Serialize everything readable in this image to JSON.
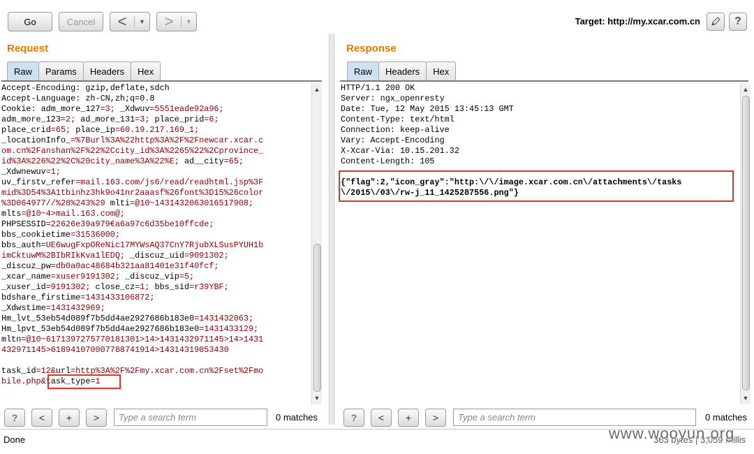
{
  "toolbar": {
    "go_label": "Go",
    "cancel_label": "Cancel",
    "back_glyph": "<",
    "forward_glyph": ">",
    "dropdown_glyph": "▼",
    "target_label": "Target: http://my.xcar.com.cn",
    "help_glyph": "?"
  },
  "request": {
    "title": "Request",
    "tabs": [
      "Raw",
      "Params",
      "Headers",
      "Hex"
    ],
    "active_tab": "Raw",
    "lines": [
      [
        {
          "t": "Accept-Encoding: gzip,deflate,sdch",
          "c": "k"
        }
      ],
      [
        {
          "t": "Accept-Language: zh-CN,zh;q=0.8",
          "c": "k"
        }
      ],
      [
        {
          "t": "Cookie: ",
          "c": "k"
        },
        {
          "t": "adm_more_127",
          "c": "k"
        },
        {
          "t": "=3; ",
          "c": "v"
        },
        {
          "t": "_Xdwuv",
          "c": "k"
        },
        {
          "t": "=5551eade92a96;",
          "c": "v"
        }
      ],
      [
        {
          "t": "adm_more_123",
          "c": "k"
        },
        {
          "t": "=2; ",
          "c": "v"
        },
        {
          "t": "ad_more_131",
          "c": "k"
        },
        {
          "t": "=3; ",
          "c": "v"
        },
        {
          "t": "place_prid",
          "c": "k"
        },
        {
          "t": "=6;",
          "c": "v"
        }
      ],
      [
        {
          "t": "place_crid",
          "c": "k"
        },
        {
          "t": "=65; ",
          "c": "v"
        },
        {
          "t": "place_ip",
          "c": "k"
        },
        {
          "t": "=60.19.217.169_1;",
          "c": "v"
        }
      ],
      [
        {
          "t": "_locationInfo_",
          "c": "k"
        },
        {
          "t": "=%7Burl%3A%22http%3A%2F%2Fnewcar.xcar.c",
          "c": "v"
        }
      ],
      [
        {
          "t": "om.cn%2Fanshan%2F%22%2Ccity_id%3A%2265%22%2Cprovince_",
          "c": "v"
        }
      ],
      [
        {
          "t": "id%3A%226%22%2C%20city_name%3A%22%E; ",
          "c": "v"
        },
        {
          "t": "ad__city",
          "c": "k"
        },
        {
          "t": "=65;",
          "c": "v"
        }
      ],
      [
        {
          "t": "_Xdwnewuv",
          "c": "k"
        },
        {
          "t": "=1;",
          "c": "v"
        }
      ],
      [
        {
          "t": "uv_firstv_refer",
          "c": "k"
        },
        {
          "t": "=mail.163.com/js6/read/readhtml.jsp%3F",
          "c": "v"
        }
      ],
      [
        {
          "t": "mid%3D54%3A1tbinhz3hk9o41nr2aaasf%26font%3D15%26color",
          "c": "v"
        }
      ],
      [
        {
          "t": "%3D064977//%28%243%29 ",
          "c": "v"
        },
        {
          "t": "mlti",
          "c": "k"
        },
        {
          "t": "=@10~1431432063016517908;",
          "c": "v"
        }
      ],
      [
        {
          "t": "mlts",
          "c": "k"
        },
        {
          "t": "=@10~4>mail.163.com@;",
          "c": "v"
        }
      ],
      [
        {
          "t": "PHPSESSID",
          "c": "k"
        },
        {
          "t": "=22626e39a979€a6a97c6d35be10ffcde;",
          "c": "v"
        }
      ],
      [
        {
          "t": "bbs_cookietime",
          "c": "k"
        },
        {
          "t": "=31536000;",
          "c": "v"
        }
      ],
      [
        {
          "t": "bbs_auth",
          "c": "k"
        },
        {
          "t": "=UE6wugFxpOReNic17MYWsAQ37CnY7RjubXLSusPYUH1b",
          "c": "v"
        }
      ],
      [
        {
          "t": "imCktuwM%2BIbRIkKva1lEDQ; ",
          "c": "v"
        },
        {
          "t": "_discuz_uid",
          "c": "k"
        },
        {
          "t": "=9091302;",
          "c": "v"
        }
      ],
      [
        {
          "t": "_discuz_pw",
          "c": "k"
        },
        {
          "t": "=db0a0ac48684b321aa81401e31f40fcf;",
          "c": "v"
        }
      ],
      [
        {
          "t": "_xcar_name",
          "c": "k"
        },
        {
          "t": "=xuser9191302; ",
          "c": "v"
        },
        {
          "t": "_discuz_vip",
          "c": "k"
        },
        {
          "t": "=5;",
          "c": "v"
        }
      ],
      [
        {
          "t": "_xuser_id",
          "c": "k"
        },
        {
          "t": "=9191302; ",
          "c": "v"
        },
        {
          "t": "close_cz",
          "c": "k"
        },
        {
          "t": "=1; ",
          "c": "v"
        },
        {
          "t": "bbs_sid",
          "c": "k"
        },
        {
          "t": "=r39YBF;",
          "c": "v"
        }
      ],
      [
        {
          "t": "bdshare_firstime",
          "c": "k"
        },
        {
          "t": "=1431433106872;",
          "c": "v"
        }
      ],
      [
        {
          "t": "_Xdwstime",
          "c": "k"
        },
        {
          "t": "=1431432969;",
          "c": "v"
        }
      ],
      [
        {
          "t": "Hm_lvt_53eb54d089f7b5dd4ae2927686b183e0",
          "c": "k"
        },
        {
          "t": "=1431432063;",
          "c": "v"
        }
      ],
      [
        {
          "t": "Hm_lpvt_53eb54d089f7b5dd4ae2927686b183e0",
          "c": "k"
        },
        {
          "t": "=1431433129;",
          "c": "v"
        }
      ],
      [
        {
          "t": "mltn",
          "c": "k"
        },
        {
          "t": "=@10~6171397275770181301>14>1431432971145>14>1431",
          "c": "v"
        }
      ],
      [
        {
          "t": "432971145>618941070007788741914>14314319053430",
          "c": "v"
        }
      ],
      [
        {
          "t": "",
          "c": "k"
        }
      ],
      [
        {
          "t": "task_id",
          "c": "k"
        },
        {
          "t": "=12&",
          "c": "v"
        },
        {
          "t": "url",
          "c": "k"
        },
        {
          "t": "=http%3A%2F%2Fmy.xcar.com.cn%2Fset%2Fmo",
          "c": "v"
        }
      ],
      [
        {
          "t": "bile.php",
          "c": "v"
        },
        {
          "t": "&",
          "c": "v"
        },
        {
          "t": "task_type",
          "c": "k"
        },
        {
          "t": "=1",
          "c": "v"
        }
      ]
    ],
    "search_placeholder": "Type a search term",
    "matches": "0 matches"
  },
  "response": {
    "title": "Response",
    "tabs": [
      "Raw",
      "Headers",
      "Hex"
    ],
    "active_tab": "Raw",
    "headers": [
      "HTTP/1.1 200 OK",
      "Server: ngx_openresty",
      "Date: Tue, 12 May 2015 13:45:13 GMT",
      "Content-Type: text/html",
      "Connection: keep-alive",
      "Vary: Accept-Encoding",
      "X-Xcar-Via: 10.15.201.32",
      "Content-Length: 105"
    ],
    "body": [
      "{\"flag\":2,\"icon_gray\":\"http:\\/\\/image.xcar.com.cn\\/attachments\\/tasks",
      "\\/2015\\/03\\/rw-j_11_1425287556.png\"}"
    ],
    "search_placeholder": "Type a search term",
    "matches": "0 matches"
  },
  "search_bar": {
    "help_glyph": "?",
    "prev_glyph": "<",
    "add_glyph": "+",
    "next_glyph": ">"
  },
  "status": {
    "left": "Done",
    "right": "363 bytes | 3,059 millis",
    "watermark": "www.wooyun.org"
  },
  "colors": {
    "section_title": "#e07b00",
    "highlight_box": "#d9332c",
    "value_text": "#8b0000"
  }
}
